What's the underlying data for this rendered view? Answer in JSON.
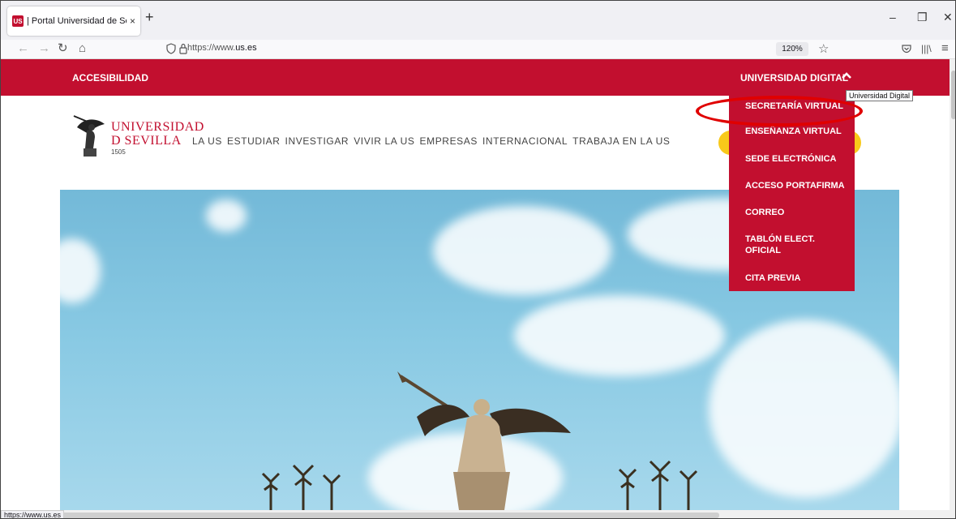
{
  "browser": {
    "tab_favicon": "US",
    "tab_title": "| Portal Universidad de Sevilla",
    "tab_close": "×",
    "new_tab": "+",
    "url_prefix": "https://www.",
    "url_domain": "us.es",
    "zoom": "120%",
    "status_url": "https://www.us.es",
    "icons": [
      "back-icon",
      "forward-icon",
      "reload-icon",
      "home-icon",
      "shield-icon",
      "lock-icon",
      "star-icon",
      "pocket-icon",
      "library-icon",
      "menu-icon"
    ]
  },
  "topbar": {
    "accessibility": "ACCESIBILIDAD",
    "digital": "UNIVERSIDAD DIGITAL",
    "tooltip": "Universidad Digital",
    "color": "#c20f2f"
  },
  "logo": {
    "line1": "UNIVERSIDAD",
    "line2": "D SEVILLA",
    "year": "1505"
  },
  "nav": {
    "items": [
      "LA US",
      "ESTUDIAR",
      "INVESTIGAR",
      "VIVIR LA US",
      "EMPRESAS",
      "INTERNACIONAL",
      "TRABAJA EN LA US"
    ]
  },
  "dropdown": {
    "items": [
      "SECRETARÍA VIRTUAL",
      "ENSEÑANZA VIRTUAL",
      "SEDE ELECTRÓNICA",
      "ACCESO PORTAFIRMA",
      "CORREO",
      "TABLÓN ELECT.",
      "OFICIAL",
      "CITA PREVIA"
    ]
  }
}
